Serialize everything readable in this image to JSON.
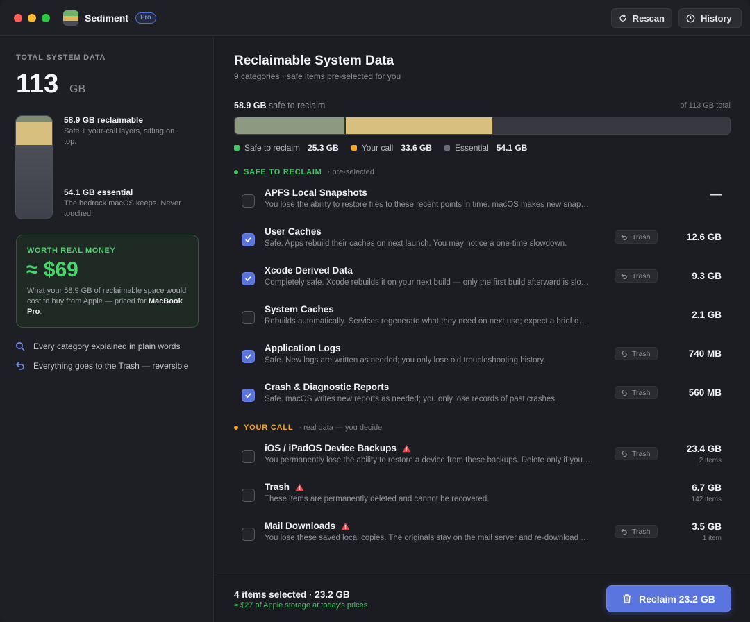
{
  "app": {
    "name": "Sediment",
    "badge": "Pro"
  },
  "toolbar": {
    "rescan": "Rescan",
    "history": "History"
  },
  "sidebar": {
    "total_label": "TOTAL SYSTEM DATA",
    "total_value": "113",
    "total_unit": "GB",
    "reclaimable_title": "58.9 GB reclaimable",
    "reclaimable_desc": "Safe + your-call layers, sitting on top.",
    "essential_title": "54.1 GB essential",
    "essential_desc": "The bedrock macOS keeps. Never touched.",
    "money": {
      "label": "WORTH REAL MONEY",
      "value": "≈ $69",
      "desc_prefix": "What your 58.9 GB of reclaimable space would cost to buy from Apple — priced for ",
      "desc_device": "MacBook Pro",
      "desc_suffix": "."
    },
    "features": [
      {
        "icon": "search-icon",
        "text": "Every category explained in plain words"
      },
      {
        "icon": "undo-icon",
        "text": "Everything goes to the Trash — reversible"
      }
    ]
  },
  "main": {
    "title": "Reclaimable System Data",
    "subtitle": "9 categories · safe items pre-selected for you",
    "bar_amount": "58.9 GB",
    "bar_label": "safe to reclaim",
    "bar_total": "of 113 GB total",
    "legend": [
      {
        "label": "Safe to reclaim",
        "value": "25.3 GB",
        "color": "#3fc463"
      },
      {
        "label": "Your call",
        "value": "33.6 GB",
        "color": "#f5a623"
      },
      {
        "label": "Essential",
        "value": "54.1 GB",
        "color": "#6b6e78"
      }
    ],
    "sections": {
      "safe": {
        "name": "SAFE TO RECLAIM",
        "note": "pre-selected",
        "color": "#3fc463"
      },
      "call": {
        "name": "YOUR CALL",
        "note": "real data — you decide",
        "color": "#f5a623"
      }
    },
    "trash_label": "Trash",
    "rows": [
      {
        "title": "APFS Local Snapshots",
        "desc": "You lose the ability to restore files to these recent points in time. macOS makes new snapshots over time.",
        "size": "—",
        "checked": false
      },
      {
        "title": "User Caches",
        "desc": "Safe. Apps rebuild their caches on next launch. You may notice a one-time slowdown.",
        "size": "12.6 GB",
        "checked": true
      },
      {
        "title": "Xcode Derived Data",
        "desc": "Completely safe. Xcode rebuilds it on your next build — only the first build afterward is slower.",
        "size": "9.3 GB",
        "checked": true
      },
      {
        "title": "System Caches",
        "desc": "Rebuilds automatically. Services regenerate what they need on next use; expect a brief one-time slowdown.",
        "size": "2.1 GB",
        "checked": false
      },
      {
        "title": "Application Logs",
        "desc": "Safe. New logs are written as needed; you only lose old troubleshooting history.",
        "size": "740 MB",
        "checked": true
      },
      {
        "title": "Crash & Diagnostic Reports",
        "desc": "Safe. macOS writes new reports as needed; you only lose records of past crashes.",
        "size": "560 MB",
        "checked": true
      },
      {
        "title": "iOS / iPadOS Device Backups",
        "desc": "You permanently lose the ability to restore a device from these backups. Delete only if you no longer need them.",
        "size": "23.4 GB",
        "count": "2 items",
        "checked": false
      },
      {
        "title": "Trash",
        "desc": "These items are permanently deleted and cannot be recovered.",
        "size": "6.7 GB",
        "count": "142 items",
        "checked": false
      },
      {
        "title": "Mail Downloads",
        "desc": "You lose these saved local copies. The originals stay on the mail server and re-download when opened.",
        "size": "3.5 GB",
        "count": "1 item",
        "checked": false
      }
    ]
  },
  "footer": {
    "selection": "4 items selected · 23.2 GB",
    "savings": "≈ $27 of Apple storage at today's prices",
    "reclaim_button": "Reclaim 23.2 GB"
  },
  "colors": {
    "accent": "#5a75e0",
    "safe_seg": "#8d9a82",
    "call_seg": "#d8bf7f",
    "essential_seg": "#373840"
  },
  "storage_bar_fractions": {
    "safe": 0.224,
    "call": 0.297
  }
}
